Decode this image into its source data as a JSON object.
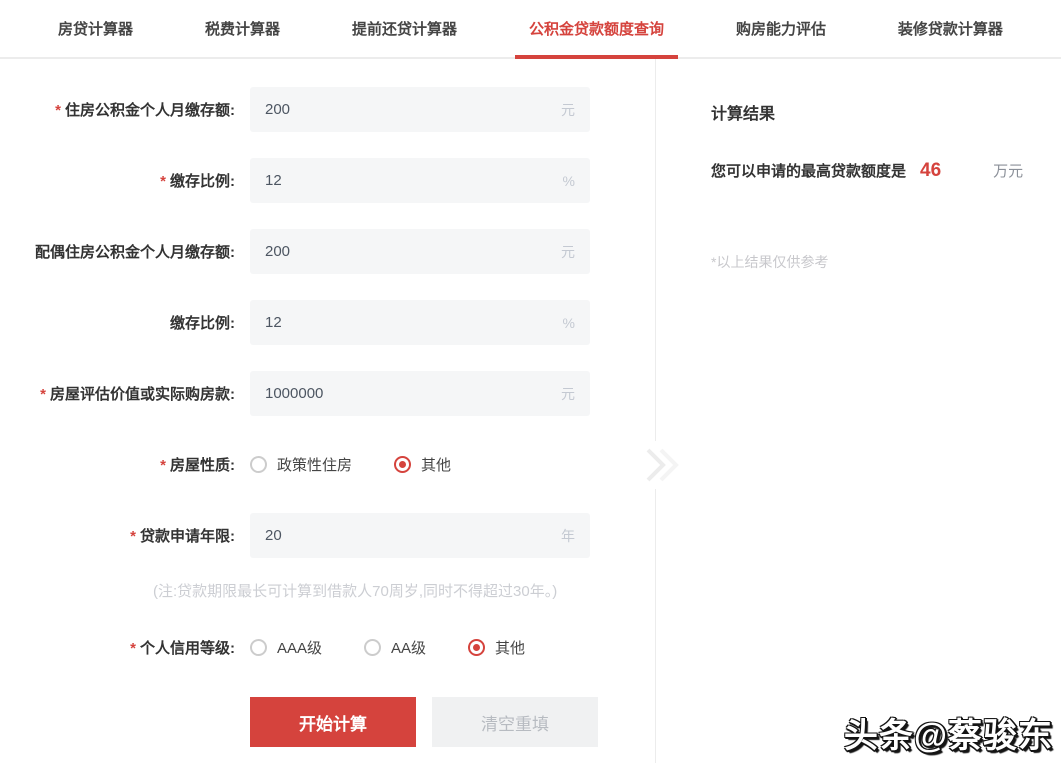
{
  "colors": {
    "accent": "#d5433d",
    "input_bg": "#f5f6f7"
  },
  "tabs": {
    "items": [
      {
        "label": "房贷计算器",
        "active": false
      },
      {
        "label": "税费计算器",
        "active": false
      },
      {
        "label": "提前还贷计算器",
        "active": false
      },
      {
        "label": "公积金贷款额度查询",
        "active": true
      },
      {
        "label": "购房能力评估",
        "active": false
      },
      {
        "label": "装修贷款计算器",
        "active": false
      }
    ]
  },
  "form": {
    "rows": [
      {
        "required_mark": "*",
        "label": "住房公积金个人月缴存额:",
        "value": "200",
        "unit": "元"
      },
      {
        "required_mark": "*",
        "label": "缴存比例:",
        "value": "12",
        "unit": "%"
      },
      {
        "label": "配偶住房公积金个人月缴存额:",
        "value": "200",
        "unit": "元"
      },
      {
        "label": "缴存比例:",
        "value": "12",
        "unit": "%"
      },
      {
        "required_mark": "*",
        "label": "房屋评估价值或实际购房款:",
        "value": "1000000",
        "unit": "元"
      },
      {
        "required_mark": "*",
        "label": "贷款申请年限:",
        "value": "20",
        "unit": "年"
      }
    ],
    "house_type": {
      "required_mark": "*",
      "label": "房屋性质:",
      "options": [
        {
          "label": "政策性住房",
          "checked": false
        },
        {
          "label": "其他",
          "checked": true
        }
      ]
    },
    "note": "(注:贷款期限最长可计算到借款人70周岁,同时不得超过30年。)",
    "credit_rating": {
      "required_mark": "*",
      "label": "个人信用等级:",
      "options": [
        {
          "label": "AAA级",
          "checked": false
        },
        {
          "label": "AA级",
          "checked": false
        },
        {
          "label": "其他",
          "checked": true
        }
      ]
    },
    "buttons": {
      "calculate": "开始计算",
      "reset": "清空重填"
    }
  },
  "result": {
    "title": "计算结果",
    "label": "您可以申请的最高贷款额度是",
    "value": "46",
    "unit": "万元",
    "disclaimer": "*以上结果仅供参考"
  },
  "watermark": "头条@蔡骏东"
}
